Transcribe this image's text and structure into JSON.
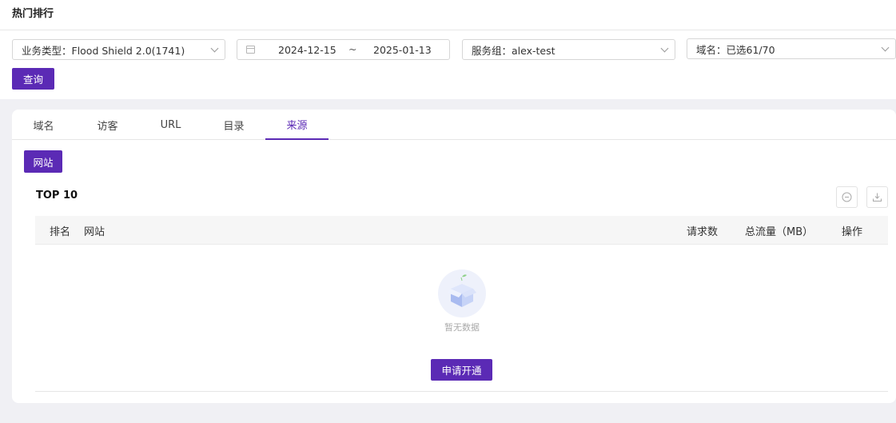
{
  "page_title": "热门排行",
  "filters": {
    "business_type": "业务类型：Flood Shield 2.0(1741)",
    "date_start": "2024-12-15",
    "date_separator": "~",
    "date_end": "2025-01-13",
    "service_group": "服务组：alex-test",
    "domain": "域名：已选61/70",
    "query_label": "查询"
  },
  "tabs": [
    {
      "label": "域名"
    },
    {
      "label": "访客"
    },
    {
      "label": "URL"
    },
    {
      "label": "目录"
    },
    {
      "label": "来源",
      "active": true
    }
  ],
  "subtab_label": "网站",
  "section_title": "TOP 10",
  "table": {
    "columns": [
      "排名",
      "网站",
      "请求数",
      "总流量（MB）",
      "操作"
    ],
    "rows": []
  },
  "empty_text": "暂无数据",
  "apply_label": "申请开通",
  "colors": {
    "accent": "#5b2ab5",
    "background": "#f0f0f4"
  }
}
